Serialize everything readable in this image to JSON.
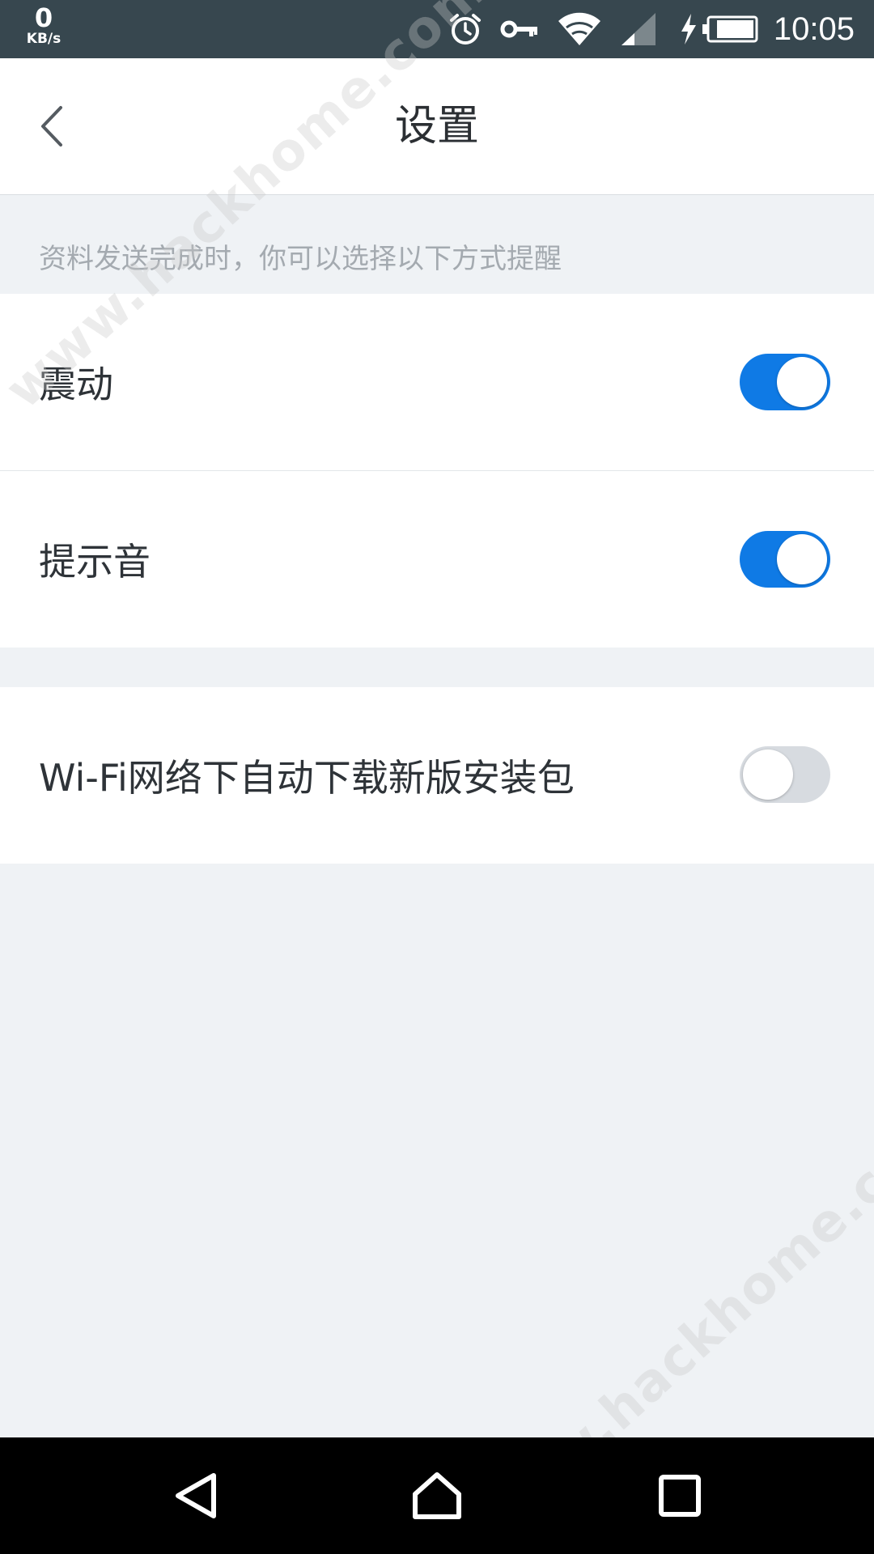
{
  "status_bar": {
    "net_speed_value": "0",
    "net_speed_unit": "KB/s",
    "time": "10:05",
    "icons": [
      "alarm-icon",
      "vpn-key-icon",
      "wifi-icon",
      "signal-icon",
      "charging-icon",
      "battery-icon"
    ]
  },
  "header": {
    "title": "设置",
    "back_icon": "chevron-left-icon"
  },
  "section_hint": "资料发送完成时，你可以选择以下方式提醒",
  "settings": [
    {
      "label": "震动",
      "enabled": true
    },
    {
      "label": "提示音",
      "enabled": true
    },
    {
      "label": "Wi-Fi网络下自动下载新版安装包",
      "enabled": false
    }
  ],
  "nav_bar": {
    "icons": [
      "back-triangle-icon",
      "home-icon",
      "recents-icon"
    ]
  },
  "watermark_text": "www.hackhome.com",
  "colors": {
    "accent": "#0f7ae5",
    "toggle_off": "#d7dbe0",
    "status_bar": "#37474f",
    "background": "#eff2f5"
  }
}
